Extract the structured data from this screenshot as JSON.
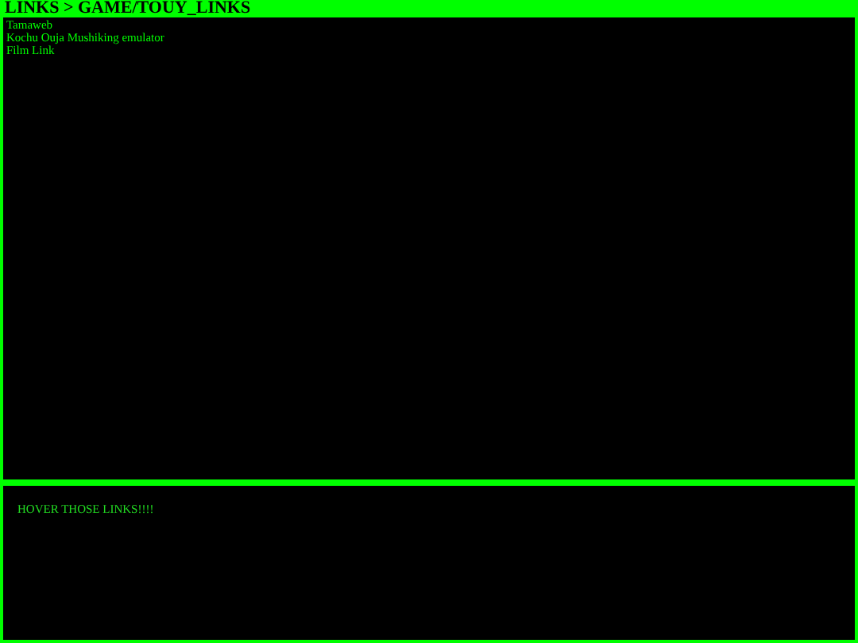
{
  "header": {
    "title": "LINKS > GAME/TOUY_LINKS"
  },
  "links": [
    "Tamaweb",
    "Kochu Ouja Mushiking emulator",
    "Film Link"
  ],
  "info_panel": {
    "text": "HOVER THOSE LINKS!!!!"
  }
}
